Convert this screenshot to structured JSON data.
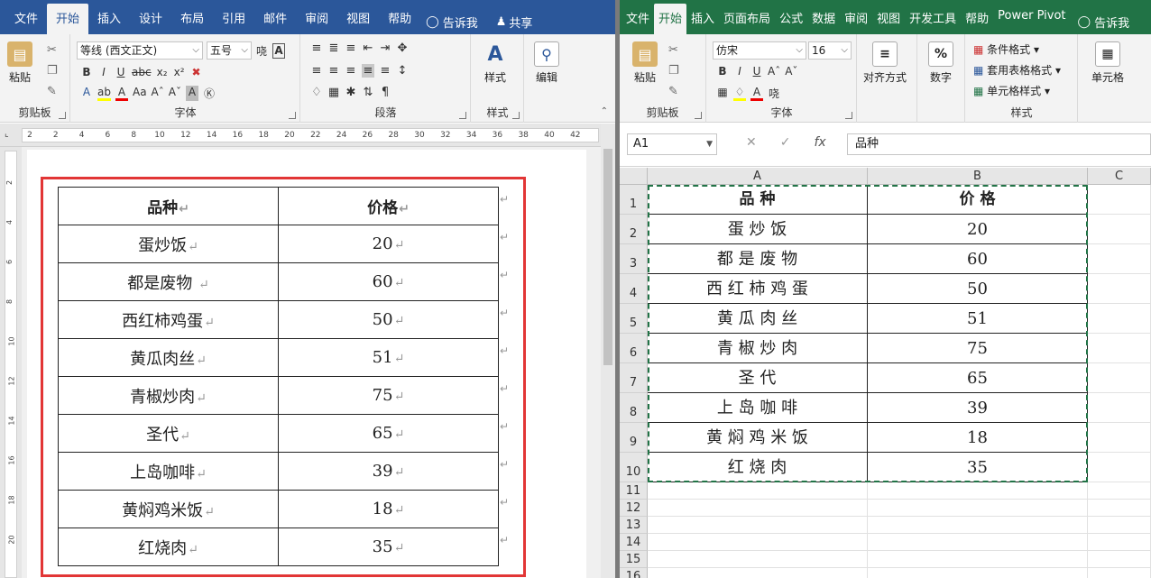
{
  "word": {
    "tabs": [
      {
        "label": "文件",
        "active": false
      },
      {
        "label": "开始",
        "active": true
      },
      {
        "label": "插入",
        "active": false
      },
      {
        "label": "设计",
        "active": false
      },
      {
        "label": "布局",
        "active": false
      },
      {
        "label": "引用",
        "active": false
      },
      {
        "label": "邮件",
        "active": false
      },
      {
        "label": "审阅",
        "active": false
      },
      {
        "label": "视图",
        "active": false
      },
      {
        "label": "帮助",
        "active": false
      }
    ],
    "tell_me": "告诉我",
    "share": "共享",
    "clipboard": {
      "paste": "粘贴",
      "label": "剪贴板"
    },
    "font": {
      "name": "等线 (西文正文)",
      "size": "五号",
      "label": "字体"
    },
    "paragraph_label": "段落",
    "styles": {
      "button": "样式",
      "label": "样式"
    },
    "editing": {
      "button": "编辑"
    },
    "ruler_ticks": [
      "2",
      "2",
      "4",
      "6",
      "8",
      "10",
      "12",
      "14",
      "16",
      "18",
      "20",
      "22",
      "24",
      "26",
      "28",
      "30",
      "32",
      "34",
      "36",
      "38",
      "40",
      "42"
    ],
    "vruler_ticks": [
      "2",
      "4",
      "6",
      "8",
      "10",
      "12",
      "14",
      "16",
      "18",
      "20"
    ],
    "table": {
      "headers": [
        "品种",
        "价格"
      ],
      "rows": [
        [
          "蛋炒饭",
          "20"
        ],
        [
          "都是废物 ",
          "60"
        ],
        [
          "西红柿鸡蛋",
          "50"
        ],
        [
          "黄瓜肉丝",
          "51"
        ],
        [
          "青椒炒肉",
          "75"
        ],
        [
          "圣代",
          "65"
        ],
        [
          "上岛咖啡",
          "39"
        ],
        [
          "黄焖鸡米饭",
          "18"
        ],
        [
          "红烧肉",
          "35"
        ]
      ]
    },
    "paragraph_mark": "↵"
  },
  "excel": {
    "tabs": [
      {
        "label": "文件",
        "active": false
      },
      {
        "label": "开始",
        "active": true
      },
      {
        "label": "插入",
        "active": false
      },
      {
        "label": "页面布局",
        "active": false
      },
      {
        "label": "公式",
        "active": false
      },
      {
        "label": "数据",
        "active": false
      },
      {
        "label": "审阅",
        "active": false
      },
      {
        "label": "视图",
        "active": false
      },
      {
        "label": "开发工具",
        "active": false
      },
      {
        "label": "帮助",
        "active": false
      },
      {
        "label": "Power Pivot",
        "active": false
      }
    ],
    "tell_me": "告诉我",
    "clipboard": {
      "paste": "粘贴",
      "label": "剪贴板"
    },
    "font": {
      "name": "仿宋",
      "size": "16",
      "label": "字体"
    },
    "alignment": {
      "button": "对齐方式"
    },
    "number": {
      "button": "数字"
    },
    "styles": {
      "conditional": "条件格式",
      "table_format": "套用表格格式",
      "cell_styles": "单元格样式",
      "label": "样式"
    },
    "cells": {
      "button": "单元格"
    },
    "name_box": "A1",
    "formula_value": "品种",
    "fx": "fx",
    "columns": [
      "A",
      "B",
      "C"
    ],
    "row_numbers": [
      "1",
      "2",
      "3",
      "4",
      "5",
      "6",
      "7",
      "8",
      "9",
      "10",
      "11",
      "12",
      "13",
      "14",
      "15",
      "16"
    ],
    "cells_data": [
      [
        "品 种",
        "价 格"
      ],
      [
        "蛋 炒 饭",
        "20"
      ],
      [
        "都 是 废 物",
        "60"
      ],
      [
        "西 红 柿 鸡 蛋",
        "50"
      ],
      [
        "黄 瓜 肉 丝",
        "51"
      ],
      [
        "青 椒 炒 肉",
        "75"
      ],
      [
        "圣 代",
        "65"
      ],
      [
        "上 岛 咖 啡",
        "39"
      ],
      [
        "黄 焖 鸡 米 饭",
        "18"
      ],
      [
        "红 烧 肉",
        "35"
      ]
    ]
  },
  "colors": {
    "word_blue": "#2b579a",
    "excel_green": "#217346",
    "highlight_red": "#e23636"
  }
}
